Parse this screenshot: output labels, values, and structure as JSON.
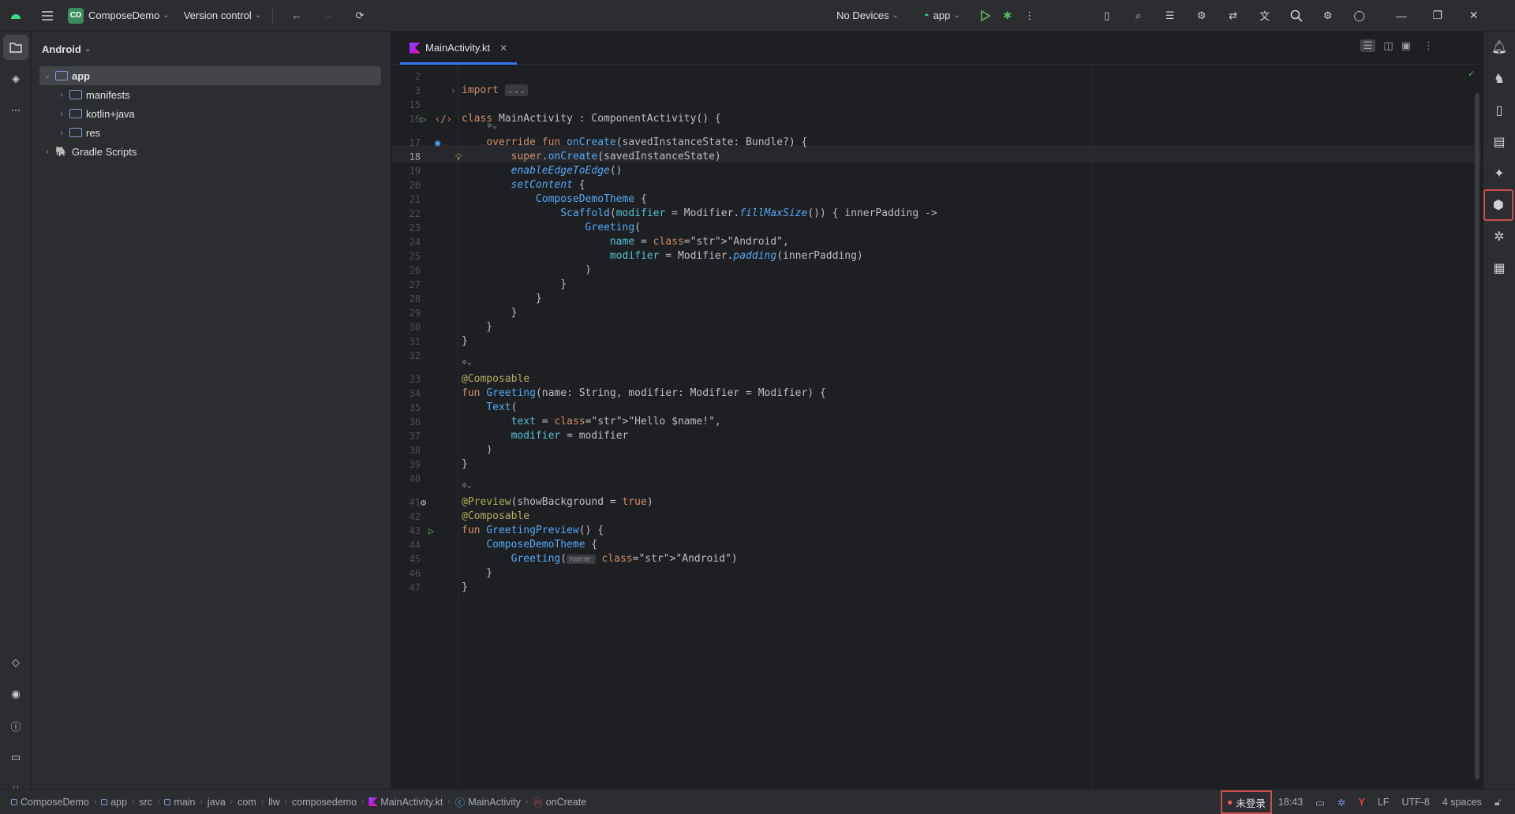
{
  "titlebar": {
    "project_badge": "CD",
    "project_name": "ComposeDemo",
    "vcs": "Version control",
    "device": "No Devices",
    "run_config": "app"
  },
  "project_panel": {
    "view_name": "Android",
    "tree": [
      {
        "label": "app",
        "level": 0,
        "expanded": true,
        "selected": true
      },
      {
        "label": "manifests",
        "level": 1
      },
      {
        "label": "kotlin+java",
        "level": 1
      },
      {
        "label": "res",
        "level": 1
      },
      {
        "label": "Gradle Scripts",
        "level": 0
      }
    ]
  },
  "editor": {
    "tab": "MainActivity.kt",
    "lines": [
      {
        "n": "2",
        "t": ""
      },
      {
        "n": "3",
        "t": "import ..."
      },
      {
        "n": "15",
        "t": ""
      },
      {
        "n": "16",
        "t": "class MainActivity : ComponentActivity() {"
      },
      {
        "n": "17",
        "t": "    override fun onCreate(savedInstanceState: Bundle?) {"
      },
      {
        "n": "18",
        "t": "        super.onCreate(savedInstanceState)"
      },
      {
        "n": "19",
        "t": "        enableEdgeToEdge()"
      },
      {
        "n": "20",
        "t": "        setContent {"
      },
      {
        "n": "21",
        "t": "            ComposeDemoTheme {"
      },
      {
        "n": "22",
        "t": "                Scaffold(modifier = Modifier.fillMaxSize()) { innerPadding ->"
      },
      {
        "n": "23",
        "t": "                    Greeting("
      },
      {
        "n": "24",
        "t": "                        name = \"Android\","
      },
      {
        "n": "25",
        "t": "                        modifier = Modifier.padding(innerPadding)"
      },
      {
        "n": "26",
        "t": "                    )"
      },
      {
        "n": "27",
        "t": "                }"
      },
      {
        "n": "28",
        "t": "            }"
      },
      {
        "n": "29",
        "t": "        }"
      },
      {
        "n": "30",
        "t": "    }"
      },
      {
        "n": "31",
        "t": "}"
      },
      {
        "n": "32",
        "t": ""
      },
      {
        "n": "33",
        "t": "@Composable"
      },
      {
        "n": "34",
        "t": "fun Greeting(name: String, modifier: Modifier = Modifier) {"
      },
      {
        "n": "35",
        "t": "    Text("
      },
      {
        "n": "36",
        "t": "        text = \"Hello $name!\","
      },
      {
        "n": "37",
        "t": "        modifier = modifier"
      },
      {
        "n": "38",
        "t": "    )"
      },
      {
        "n": "39",
        "t": "}"
      },
      {
        "n": "40",
        "t": ""
      },
      {
        "n": "41",
        "t": "@Preview(showBackground = true)"
      },
      {
        "n": "42",
        "t": "@Composable"
      },
      {
        "n": "43",
        "t": "fun GreetingPreview() {"
      },
      {
        "n": "44",
        "t": "    ComposeDemoTheme {"
      },
      {
        "n": "45",
        "t": "        Greeting( name: \"Android\")"
      },
      {
        "n": "46",
        "t": "    }"
      },
      {
        "n": "47",
        "t": "}"
      }
    ],
    "param_hint": "name:"
  },
  "statusbar": {
    "breadcrumbs": [
      "ComposeDemo",
      "app",
      "src",
      "main",
      "java",
      "com",
      "llw",
      "composedemo",
      "MainActivity.kt",
      "MainActivity",
      "onCreate"
    ],
    "login": "未登录",
    "position": "18:43",
    "line_sep": "LF",
    "encoding": "UTF-8",
    "indent": "4 spaces"
  },
  "colors": {
    "accent": "#3574f0",
    "keyword": "#cf8e6d",
    "function": "#56a8f5",
    "string": "#6aab73",
    "annotation": "#b3ae60",
    "highlight_border": "#c94f4f"
  }
}
